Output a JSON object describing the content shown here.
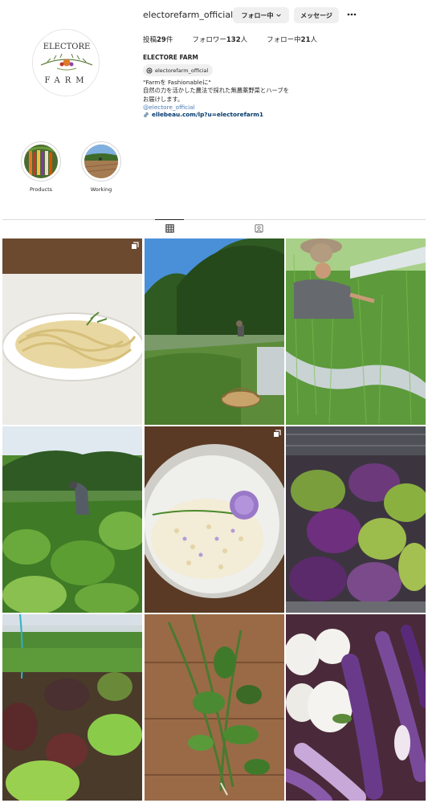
{
  "profile": {
    "username": "electorefarm_official",
    "follow_button": "フォロー中",
    "message_button": "メッセージ",
    "posts_label": "投稿",
    "posts_count": "29",
    "posts_unit": "件",
    "followers_label": "フォロワー",
    "followers_count": "132",
    "followers_unit": "人",
    "following_label": "フォロー中",
    "following_count": "21",
    "following_unit": "人",
    "full_name": "ELECTORE FARM",
    "threads_handle": "electorefarm_official",
    "bio_line1": "\"Farmを Fashionableに\"",
    "bio_line2": "自然の力を活かした農法で採れた無農薬野菜とハーブを",
    "bio_line3": "お届けします。",
    "bio_mention": "@electore_official",
    "external_link": "ellebeau.com/lp?u=electorefarm1",
    "avatar_logo_top": "ELECTORE",
    "avatar_logo_bottom": "FARM"
  },
  "highlights": [
    {
      "label": "Products"
    },
    {
      "label": "Working"
    }
  ],
  "tabs": [
    {
      "name": "posts",
      "icon": "grid-icon",
      "active": true
    },
    {
      "name": "tagged",
      "icon": "tagged-person-icon",
      "active": false
    }
  ],
  "posts": [
    {
      "subject": "pasta",
      "multi": true
    },
    {
      "subject": "field-worker-basket",
      "multi": false
    },
    {
      "subject": "harvesting-fennel",
      "multi": false
    },
    {
      "subject": "zucchini-field",
      "multi": false
    },
    {
      "subject": "risotto-chive-flower",
      "multi": true
    },
    {
      "subject": "purple-kale",
      "multi": false
    },
    {
      "subject": "lettuce-rows",
      "multi": false
    },
    {
      "subject": "herb-bundle",
      "multi": false
    },
    {
      "subject": "eggplants",
      "multi": false
    }
  ],
  "colors": {
    "link": "#00376b",
    "button_bg": "#efefef",
    "border": "#dbdbdb"
  }
}
